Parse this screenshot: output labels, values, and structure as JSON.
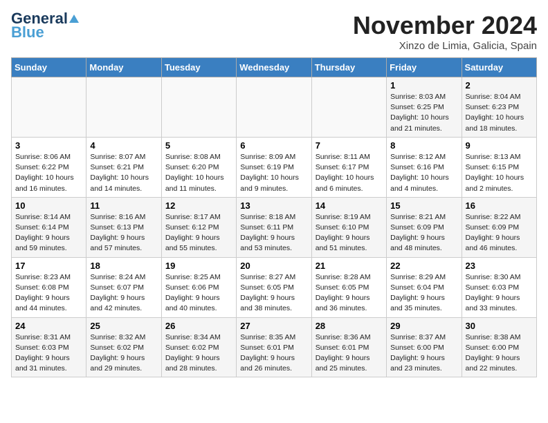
{
  "header": {
    "logo_line1": "General",
    "logo_line2": "Blue",
    "month": "November 2024",
    "location": "Xinzo de Limia, Galicia, Spain"
  },
  "weekdays": [
    "Sunday",
    "Monday",
    "Tuesday",
    "Wednesday",
    "Thursday",
    "Friday",
    "Saturday"
  ],
  "weeks": [
    [
      {
        "day": "",
        "info": ""
      },
      {
        "day": "",
        "info": ""
      },
      {
        "day": "",
        "info": ""
      },
      {
        "day": "",
        "info": ""
      },
      {
        "day": "",
        "info": ""
      },
      {
        "day": "1",
        "info": "Sunrise: 8:03 AM\nSunset: 6:25 PM\nDaylight: 10 hours\nand 21 minutes."
      },
      {
        "day": "2",
        "info": "Sunrise: 8:04 AM\nSunset: 6:23 PM\nDaylight: 10 hours\nand 18 minutes."
      }
    ],
    [
      {
        "day": "3",
        "info": "Sunrise: 8:06 AM\nSunset: 6:22 PM\nDaylight: 10 hours\nand 16 minutes."
      },
      {
        "day": "4",
        "info": "Sunrise: 8:07 AM\nSunset: 6:21 PM\nDaylight: 10 hours\nand 14 minutes."
      },
      {
        "day": "5",
        "info": "Sunrise: 8:08 AM\nSunset: 6:20 PM\nDaylight: 10 hours\nand 11 minutes."
      },
      {
        "day": "6",
        "info": "Sunrise: 8:09 AM\nSunset: 6:19 PM\nDaylight: 10 hours\nand 9 minutes."
      },
      {
        "day": "7",
        "info": "Sunrise: 8:11 AM\nSunset: 6:17 PM\nDaylight: 10 hours\nand 6 minutes."
      },
      {
        "day": "8",
        "info": "Sunrise: 8:12 AM\nSunset: 6:16 PM\nDaylight: 10 hours\nand 4 minutes."
      },
      {
        "day": "9",
        "info": "Sunrise: 8:13 AM\nSunset: 6:15 PM\nDaylight: 10 hours\nand 2 minutes."
      }
    ],
    [
      {
        "day": "10",
        "info": "Sunrise: 8:14 AM\nSunset: 6:14 PM\nDaylight: 9 hours\nand 59 minutes."
      },
      {
        "day": "11",
        "info": "Sunrise: 8:16 AM\nSunset: 6:13 PM\nDaylight: 9 hours\nand 57 minutes."
      },
      {
        "day": "12",
        "info": "Sunrise: 8:17 AM\nSunset: 6:12 PM\nDaylight: 9 hours\nand 55 minutes."
      },
      {
        "day": "13",
        "info": "Sunrise: 8:18 AM\nSunset: 6:11 PM\nDaylight: 9 hours\nand 53 minutes."
      },
      {
        "day": "14",
        "info": "Sunrise: 8:19 AM\nSunset: 6:10 PM\nDaylight: 9 hours\nand 51 minutes."
      },
      {
        "day": "15",
        "info": "Sunrise: 8:21 AM\nSunset: 6:09 PM\nDaylight: 9 hours\nand 48 minutes."
      },
      {
        "day": "16",
        "info": "Sunrise: 8:22 AM\nSunset: 6:09 PM\nDaylight: 9 hours\nand 46 minutes."
      }
    ],
    [
      {
        "day": "17",
        "info": "Sunrise: 8:23 AM\nSunset: 6:08 PM\nDaylight: 9 hours\nand 44 minutes."
      },
      {
        "day": "18",
        "info": "Sunrise: 8:24 AM\nSunset: 6:07 PM\nDaylight: 9 hours\nand 42 minutes."
      },
      {
        "day": "19",
        "info": "Sunrise: 8:25 AM\nSunset: 6:06 PM\nDaylight: 9 hours\nand 40 minutes."
      },
      {
        "day": "20",
        "info": "Sunrise: 8:27 AM\nSunset: 6:05 PM\nDaylight: 9 hours\nand 38 minutes."
      },
      {
        "day": "21",
        "info": "Sunrise: 8:28 AM\nSunset: 6:05 PM\nDaylight: 9 hours\nand 36 minutes."
      },
      {
        "day": "22",
        "info": "Sunrise: 8:29 AM\nSunset: 6:04 PM\nDaylight: 9 hours\nand 35 minutes."
      },
      {
        "day": "23",
        "info": "Sunrise: 8:30 AM\nSunset: 6:03 PM\nDaylight: 9 hours\nand 33 minutes."
      }
    ],
    [
      {
        "day": "24",
        "info": "Sunrise: 8:31 AM\nSunset: 6:03 PM\nDaylight: 9 hours\nand 31 minutes."
      },
      {
        "day": "25",
        "info": "Sunrise: 8:32 AM\nSunset: 6:02 PM\nDaylight: 9 hours\nand 29 minutes."
      },
      {
        "day": "26",
        "info": "Sunrise: 8:34 AM\nSunset: 6:02 PM\nDaylight: 9 hours\nand 28 minutes."
      },
      {
        "day": "27",
        "info": "Sunrise: 8:35 AM\nSunset: 6:01 PM\nDaylight: 9 hours\nand 26 minutes."
      },
      {
        "day": "28",
        "info": "Sunrise: 8:36 AM\nSunset: 6:01 PM\nDaylight: 9 hours\nand 25 minutes."
      },
      {
        "day": "29",
        "info": "Sunrise: 8:37 AM\nSunset: 6:00 PM\nDaylight: 9 hours\nand 23 minutes."
      },
      {
        "day": "30",
        "info": "Sunrise: 8:38 AM\nSunset: 6:00 PM\nDaylight: 9 hours\nand 22 minutes."
      }
    ]
  ]
}
